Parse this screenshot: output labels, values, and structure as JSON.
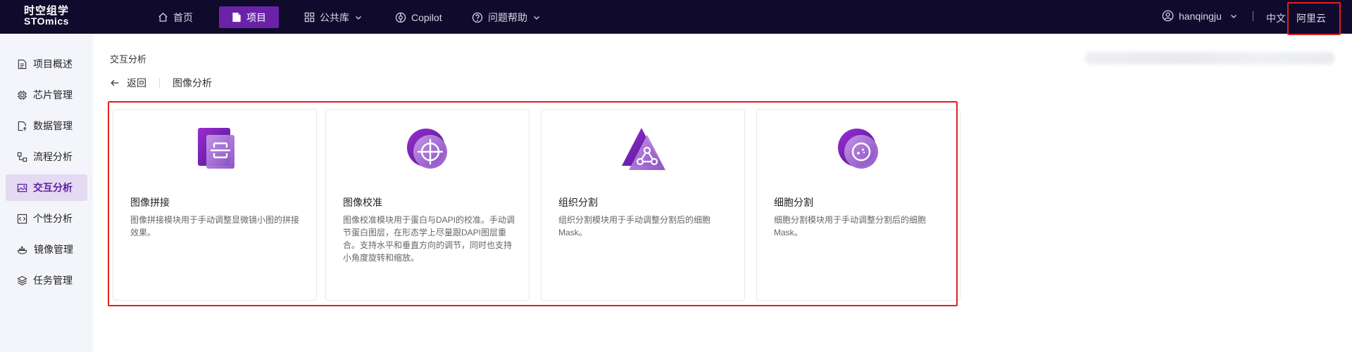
{
  "brand": {
    "line1": "时空组学",
    "line2": "STOmics"
  },
  "nav": {
    "home": "首页",
    "project": "项目",
    "library": "公共库",
    "copilot": "Copilot",
    "help": "问题帮助"
  },
  "user": {
    "name": "hanqingju"
  },
  "lang": "中文",
  "cloud": "阿里云",
  "sidebar": {
    "items": [
      {
        "label": "项目概述"
      },
      {
        "label": "芯片管理"
      },
      {
        "label": "数据管理"
      },
      {
        "label": "流程分析"
      },
      {
        "label": "交互分析"
      },
      {
        "label": "个性分析"
      },
      {
        "label": "镜像管理"
      },
      {
        "label": "任务管理"
      }
    ]
  },
  "breadcrumb": "交互分析",
  "back_label": "返回",
  "section_title": "图像分析",
  "cards": [
    {
      "title": "图像拼接",
      "desc": "图像拼接模块用于手动调整显微镜小图的拼接效果。"
    },
    {
      "title": "图像校准",
      "desc": "图像校准模块用于蛋白与DAPI的校准。手动调节蛋白图层，在形态学上尽量跟DAPI图层重合。支持水平和垂直方向的调节，同时也支持小角度旋转和缩放。"
    },
    {
      "title": "组织分割",
      "desc": "组织分割模块用于手动调整分割后的细胞Mask。"
    },
    {
      "title": "细胞分割",
      "desc": "细胞分割模块用于手动调整分割后的细胞Mask。"
    }
  ],
  "colors": {
    "topbar": "#100a2c",
    "accent": "#6a23a8",
    "sidebar_active_bg": "#e4daf1",
    "highlight": "#e1201c"
  }
}
